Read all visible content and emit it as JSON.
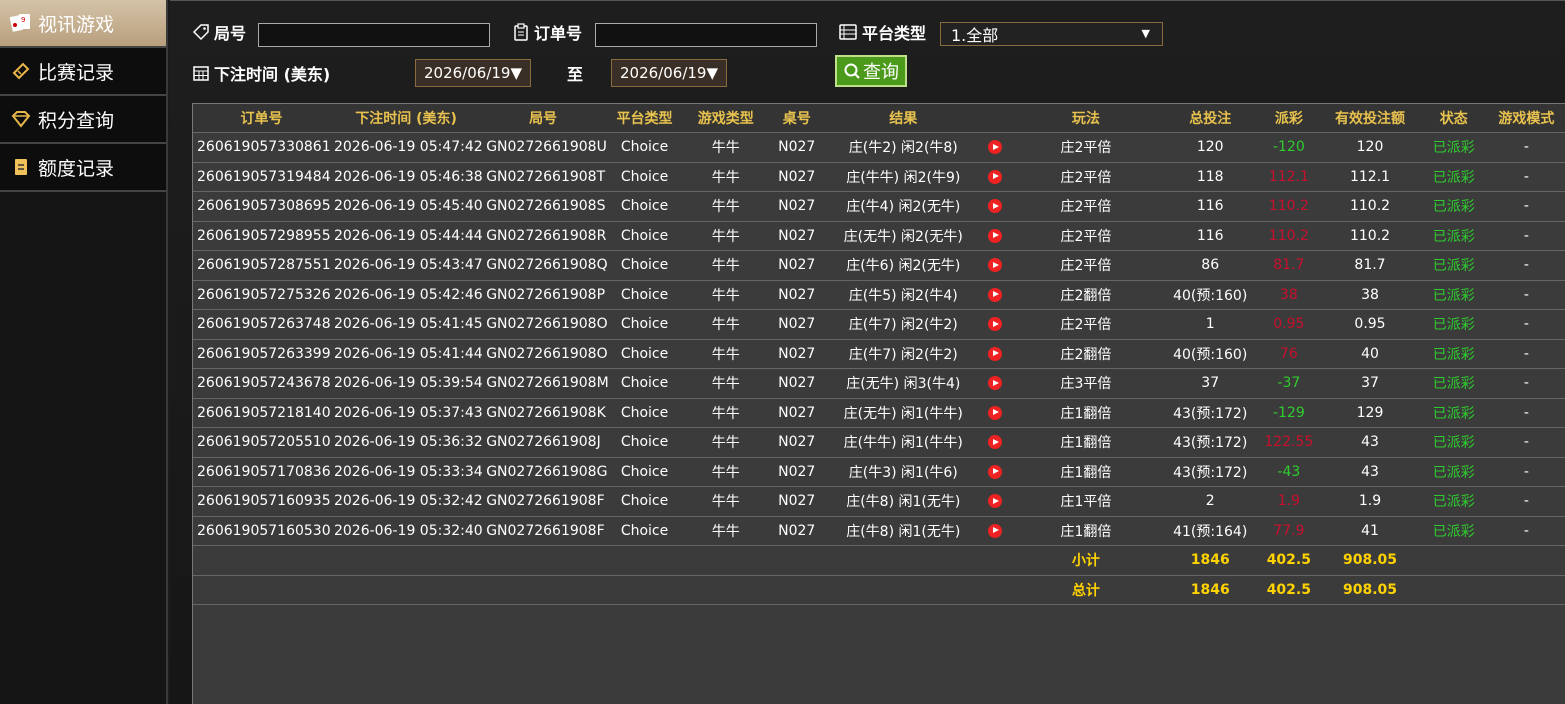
{
  "sidebar": {
    "items": [
      {
        "label": "视讯游戏",
        "icon": "playing-cards-icon",
        "active": true
      },
      {
        "label": "比赛记录",
        "icon": "ticket-icon",
        "active": false
      },
      {
        "label": "积分查询",
        "icon": "diamond-icon",
        "active": false
      },
      {
        "label": "额度记录",
        "icon": "document-icon",
        "active": false
      }
    ]
  },
  "filters": {
    "round_label": "局号",
    "round_value": "",
    "order_label": "订单号",
    "order_value": "",
    "platform_label": "平台类型",
    "platform_value": "1.全部",
    "bet_time_label": "下注时间 (美东)",
    "date_from": "2026/06/19▼",
    "to_label": "至",
    "date_to": "2026/06/19▼",
    "query_label": "查询"
  },
  "table": {
    "headers": [
      "订单号",
      "下注时间 (美东)",
      "局号",
      "平台类型",
      "游戏类型",
      "桌号",
      "结果",
      "",
      "玩法",
      "总投注",
      "派彩",
      "有效投注额",
      "状态",
      "游戏模式"
    ],
    "rows": [
      [
        "260619057330861",
        "2026-06-19 05:47:42",
        "GN0272661908U",
        "Choice",
        "牛牛",
        "N027",
        "庄(牛2) 闲2(牛8)",
        "",
        "庄2平倍",
        "120",
        "-120",
        "120",
        "已派彩",
        "-"
      ],
      [
        "260619057319484",
        "2026-06-19 05:46:38",
        "GN0272661908T",
        "Choice",
        "牛牛",
        "N027",
        "庄(牛牛) 闲2(牛9)",
        "",
        "庄2平倍",
        "118",
        "112.1",
        "112.1",
        "已派彩",
        "-"
      ],
      [
        "260619057308695",
        "2026-06-19 05:45:40",
        "GN0272661908S",
        "Choice",
        "牛牛",
        "N027",
        "庄(牛4) 闲2(无牛)",
        "",
        "庄2平倍",
        "116",
        "110.2",
        "110.2",
        "已派彩",
        "-"
      ],
      [
        "260619057298955",
        "2026-06-19 05:44:44",
        "GN0272661908R",
        "Choice",
        "牛牛",
        "N027",
        "庄(无牛) 闲2(无牛)",
        "",
        "庄2平倍",
        "116",
        "110.2",
        "110.2",
        "已派彩",
        "-"
      ],
      [
        "260619057287551",
        "2026-06-19 05:43:47",
        "GN0272661908Q",
        "Choice",
        "牛牛",
        "N027",
        "庄(牛6) 闲2(无牛)",
        "",
        "庄2平倍",
        "86",
        "81.7",
        "81.7",
        "已派彩",
        "-"
      ],
      [
        "260619057275326",
        "2026-06-19 05:42:46",
        "GN0272661908P",
        "Choice",
        "牛牛",
        "N027",
        "庄(牛5) 闲2(牛4)",
        "",
        "庄2翻倍",
        "40(预:160)",
        "38",
        "38",
        "已派彩",
        "-"
      ],
      [
        "260619057263748",
        "2026-06-19 05:41:45",
        "GN0272661908O",
        "Choice",
        "牛牛",
        "N027",
        "庄(牛7) 闲2(牛2)",
        "",
        "庄2平倍",
        "1",
        "0.95",
        "0.95",
        "已派彩",
        "-"
      ],
      [
        "260619057263399",
        "2026-06-19 05:41:44",
        "GN0272661908O",
        "Choice",
        "牛牛",
        "N027",
        "庄(牛7) 闲2(牛2)",
        "",
        "庄2翻倍",
        "40(预:160)",
        "76",
        "40",
        "已派彩",
        "-"
      ],
      [
        "260619057243678",
        "2026-06-19 05:39:54",
        "GN0272661908M",
        "Choice",
        "牛牛",
        "N027",
        "庄(无牛) 闲3(牛4)",
        "",
        "庄3平倍",
        "37",
        "-37",
        "37",
        "已派彩",
        "-"
      ],
      [
        "260619057218140",
        "2026-06-19 05:37:43",
        "GN0272661908K",
        "Choice",
        "牛牛",
        "N027",
        "庄(无牛) 闲1(牛牛)",
        "",
        "庄1翻倍",
        "43(预:172)",
        "-129",
        "129",
        "已派彩",
        "-"
      ],
      [
        "260619057205510",
        "2026-06-19 05:36:32",
        "GN0272661908J",
        "Choice",
        "牛牛",
        "N027",
        "庄(牛牛) 闲1(牛牛)",
        "",
        "庄1翻倍",
        "43(预:172)",
        "122.55",
        "43",
        "已派彩",
        "-"
      ],
      [
        "260619057170836",
        "2026-06-19 05:33:34",
        "GN0272661908G",
        "Choice",
        "牛牛",
        "N027",
        "庄(牛3) 闲1(牛6)",
        "",
        "庄1翻倍",
        "43(预:172)",
        "-43",
        "43",
        "已派彩",
        "-"
      ],
      [
        "260619057160935",
        "2026-06-19 05:32:42",
        "GN0272661908F",
        "Choice",
        "牛牛",
        "N027",
        "庄(牛8) 闲1(无牛)",
        "",
        "庄1平倍",
        "2",
        "1.9",
        "1.9",
        "已派彩",
        "-"
      ],
      [
        "260619057160530",
        "2026-06-19 05:32:40",
        "GN0272661908F",
        "Choice",
        "牛牛",
        "N027",
        "庄(牛8) 闲1(无牛)",
        "",
        "庄1翻倍",
        "41(预:164)",
        "77.9",
        "41",
        "已派彩",
        "-"
      ]
    ],
    "payout_colors": {
      "positive": "#c8102e",
      "negative": "#2ecc2e"
    },
    "subtotal": {
      "label": "小计",
      "total_bet": "1846",
      "payout": "402.5",
      "valid_bet": "908.05"
    },
    "total": {
      "label": "总计",
      "total_bet": "1846",
      "payout": "402.5",
      "valid_bet": "908.05"
    }
  }
}
